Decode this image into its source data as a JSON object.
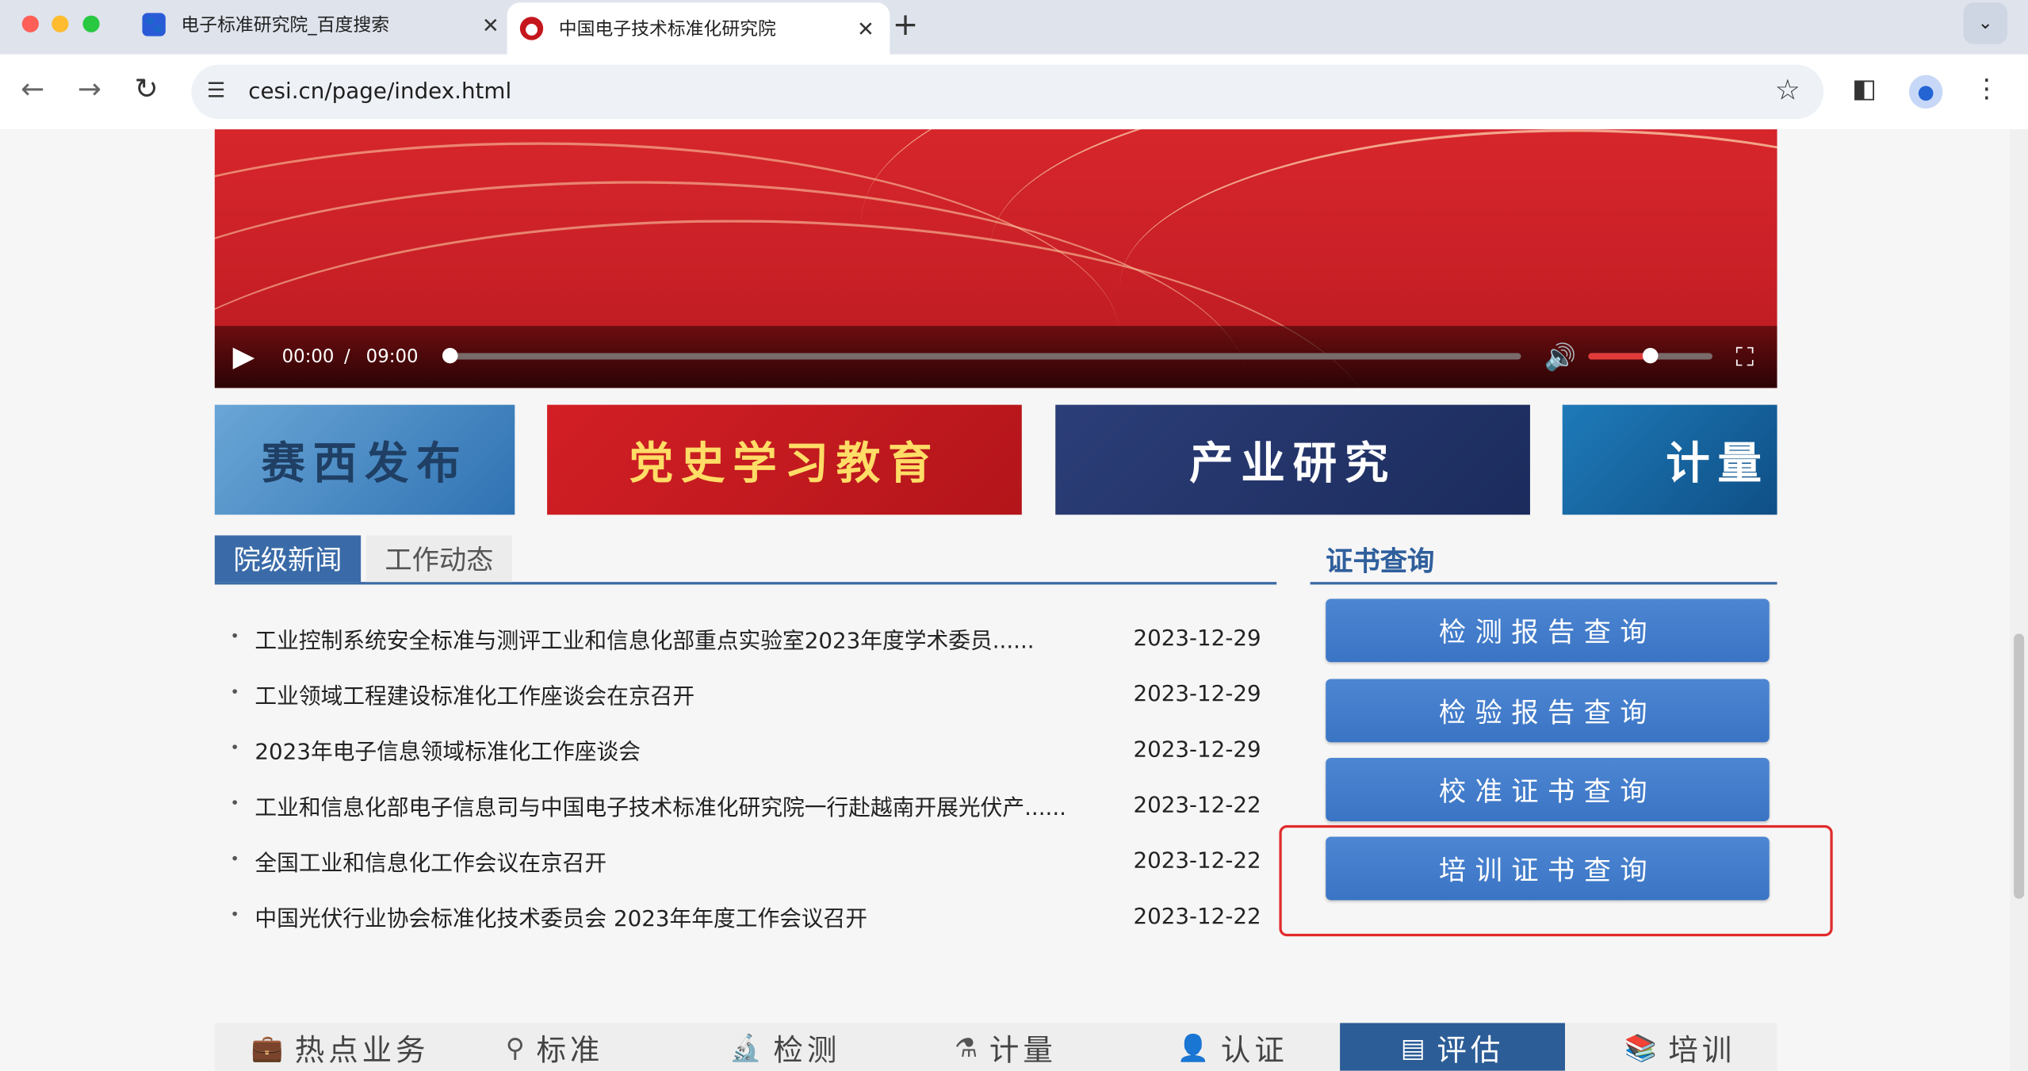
{
  "browser": {
    "tabs": [
      {
        "title": "电子标准研究院_百度搜索",
        "favicon": "baidu-paw-icon"
      },
      {
        "title": "中国电子技术标准化研究院",
        "favicon": "cesi-logo-icon",
        "active": true
      }
    ],
    "url": "cesi.cn/page/index.html"
  },
  "video": {
    "current_time": "00:00",
    "separator": "/",
    "duration": "09:00",
    "progress": 0,
    "volume": 0.5
  },
  "banners": [
    {
      "text": "赛西发布"
    },
    {
      "text": "党史学习教育"
    },
    {
      "text": "产业研究"
    },
    {
      "text": "计量"
    }
  ],
  "news": {
    "tabs": [
      "院级新闻",
      "工作动态"
    ],
    "active_tab": 0,
    "items": [
      {
        "title": "工业控制系统安全标准与测评工业和信息化部重点实验室2023年度学术委员......",
        "date": "2023-12-29"
      },
      {
        "title": "工业领域工程建设标准化工作座谈会在京召开",
        "date": "2023-12-29"
      },
      {
        "title": "2023年电子信息领域标准化工作座谈会",
        "date": "2023-12-29"
      },
      {
        "title": "工业和信息化部电子信息司与中国电子技术标准化研究院一行赴越南开展光伏产......",
        "date": "2023-12-22"
      },
      {
        "title": "全国工业和信息化工作会议在京召开",
        "date": "2023-12-22"
      },
      {
        "title": "中国光伏行业协会标准化技术委员会 2023年年度工作会议召开",
        "date": "2023-12-22"
      }
    ]
  },
  "certificate": {
    "title": "证书查询",
    "buttons": [
      "检测报告查询",
      "检验报告查询",
      "校准证书查询",
      "培训证书查询"
    ],
    "highlighted_index": 3
  },
  "bottom_nav": {
    "items": [
      {
        "label": "热点业务",
        "icon": "briefcase-icon"
      },
      {
        "label": "标准",
        "icon": "compass-icon"
      },
      {
        "label": "检测",
        "icon": "microscope-icon"
      },
      {
        "label": "计量",
        "icon": "flask-icon"
      },
      {
        "label": "认证",
        "icon": "person-icon"
      },
      {
        "label": "评估",
        "icon": "document-icon",
        "active": true
      },
      {
        "label": "培训",
        "icon": "books-icon"
      }
    ]
  },
  "colors": {
    "accent_blue": "#3a6ba8",
    "button_blue": "#4d86d2",
    "highlight_red": "#e12b2b",
    "video_red": "#c81f26"
  }
}
